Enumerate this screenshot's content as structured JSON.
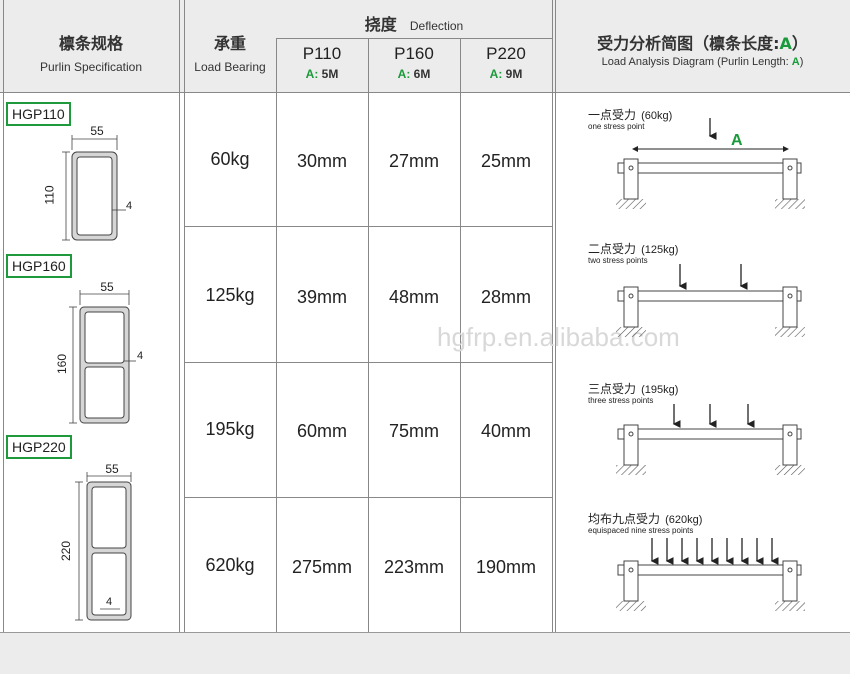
{
  "header": {
    "spec_cn": "檩条规格",
    "spec_en": "Purlin Specification",
    "load_cn": "承重",
    "load_en": "Load Bearing",
    "deflection_cn": "挠度",
    "deflection_en": "Deflection",
    "models": [
      {
        "name": "P110",
        "length_label": "A:",
        "length": "5M"
      },
      {
        "name": "P160",
        "length_label": "A:",
        "length": "6M"
      },
      {
        "name": "P220",
        "length_label": "A:",
        "length": "9M"
      }
    ],
    "analysis_cn": "受力分析简图（檩条长度:",
    "analysis_cn_var": "A",
    "analysis_cn_end": "）",
    "analysis_en": "Load Analysis Diagram (Purlin Length:",
    "analysis_en_var": "A",
    "analysis_en_end": ")"
  },
  "profiles": [
    {
      "tag": "HGP110",
      "width": "55",
      "height": "110",
      "thickness": "4"
    },
    {
      "tag": "HGP160",
      "width": "55",
      "height": "160",
      "thickness": "4"
    },
    {
      "tag": "HGP220",
      "width": "55",
      "height": "220",
      "thickness": "4"
    }
  ],
  "rows": [
    {
      "load": "60kg",
      "p110": "30mm",
      "p160": "27mm",
      "p220": "25mm"
    },
    {
      "load": "125kg",
      "p110": "39mm",
      "p160": "48mm",
      "p220": "28mm"
    },
    {
      "load": "195kg",
      "p110": "60mm",
      "p160": "75mm",
      "p220": "40mm"
    },
    {
      "load": "620kg",
      "p110": "275mm",
      "p160": "223mm",
      "p220": "190mm"
    }
  ],
  "diagrams": [
    {
      "cn": "一点受力",
      "kg": "(60kg)",
      "en": "one stress point",
      "span": "A"
    },
    {
      "cn": "二点受力",
      "kg": "(125kg)",
      "en": "two stress points"
    },
    {
      "cn": "三点受力",
      "kg": "(195kg)",
      "en": "three stress points"
    },
    {
      "cn": "均布九点受力",
      "kg": "(620kg)",
      "en": "equispaced nine stress points"
    }
  ],
  "watermark": "hgfrp.en.alibaba.com",
  "colors": {
    "accent": "#1a9a3a",
    "header_bg": "#ececec",
    "grid": "#888888"
  }
}
